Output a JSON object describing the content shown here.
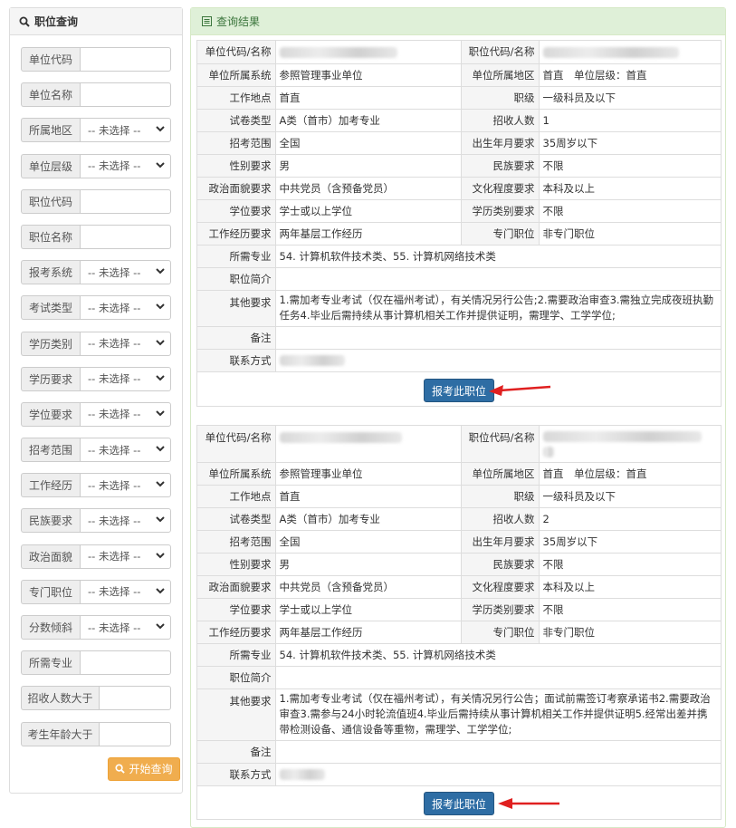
{
  "sidebar": {
    "title": "职位查询",
    "select_placeholder": "-- 未选择 --",
    "fields": [
      {
        "label": "单位代码",
        "type": "input"
      },
      {
        "label": "单位名称",
        "type": "input"
      },
      {
        "label": "所属地区",
        "type": "select"
      },
      {
        "label": "单位层级",
        "type": "select"
      },
      {
        "label": "职位代码",
        "type": "input"
      },
      {
        "label": "职位名称",
        "type": "input"
      },
      {
        "label": "报考系统",
        "type": "select"
      },
      {
        "label": "考试类型",
        "type": "select"
      },
      {
        "label": "学历类别",
        "type": "select"
      },
      {
        "label": "学历要求",
        "type": "select"
      },
      {
        "label": "学位要求",
        "type": "select"
      },
      {
        "label": "招考范围",
        "type": "select"
      },
      {
        "label": "工作经历",
        "type": "select"
      },
      {
        "label": "民族要求",
        "type": "select"
      },
      {
        "label": "政治面貌",
        "type": "select"
      },
      {
        "label": "专门职位",
        "type": "select"
      },
      {
        "label": "分数倾斜",
        "type": "select"
      },
      {
        "label": "所需专业",
        "type": "input"
      },
      {
        "label": "招收人数大于",
        "type": "input"
      },
      {
        "label": "考生年龄大于",
        "type": "input"
      }
    ],
    "search_button": "开始查询"
  },
  "results": {
    "title": "查询结果",
    "apply_button": "报考此职位",
    "labels": {
      "unit_code_name": "单位代码/名称",
      "position_code_name": "职位代码/名称",
      "unit_system": "单位所属系统",
      "unit_region": "单位所属地区",
      "work_location": "工作地点",
      "rank": "职级",
      "exam_type": "试卷类型",
      "recruit_count": "招收人数",
      "scope": "招考范围",
      "birth_req": "出生年月要求",
      "gender": "性别要求",
      "ethnicity": "民族要求",
      "political": "政治面貌要求",
      "education": "文化程度要求",
      "degree": "学位要求",
      "edu_category": "学历类别要求",
      "work_exp": "工作经历要求",
      "special_position": "专门职位",
      "major": "所需专业",
      "intro": "职位简介",
      "other": "其他要求",
      "remark": "备注",
      "contact": "联系方式"
    },
    "cards": [
      {
        "unit_system": "参照管理事业单位",
        "unit_region": "首直　单位层级：首直",
        "work_location": "首直",
        "rank": "一级科员及以下",
        "exam_type": "A类（首市）加考专业",
        "recruit_count": "1",
        "scope": "全国",
        "birth_req": "35周岁以下",
        "gender": "男",
        "ethnicity": "不限",
        "political": "中共党员（含预备党员）",
        "education": "本科及以上",
        "degree": "学士或以上学位",
        "edu_category": "不限",
        "work_exp": "两年基层工作经历",
        "special_position": "非专门职位",
        "major": "54. 计算机软件技术类、55. 计算机网络技术类",
        "intro": "",
        "other": "1.需加考专业考试（仅在福州考试），有关情况另行公告;2.需要政治审查3.需独立完成夜班执勤任务4.毕业后需持续从事计算机相关工作并提供证明，需理学、工学学位;",
        "remark": ""
      },
      {
        "unit_system": "参照管理事业单位",
        "unit_region": "首直　单位层级：首直",
        "work_location": "首直",
        "rank": "一级科员及以下",
        "exam_type": "A类（首市）加考专业",
        "recruit_count": "2",
        "scope": "全国",
        "birth_req": "35周岁以下",
        "gender": "男",
        "ethnicity": "不限",
        "political": "中共党员（含预备党员）",
        "education": "本科及以上",
        "degree": "学士或以上学位",
        "edu_category": "不限",
        "work_exp": "两年基层工作经历",
        "special_position": "非专门职位",
        "major": "54. 计算机软件技术类、55. 计算机网络技术类",
        "intro": "",
        "other": "1.需加考专业考试（仅在福州考试），有关情况另行公告；面试前需签订考察承诺书2.需要政治审查3.需参与24小时轮流值班4.毕业后需持续从事计算机相关工作并提供证明5.经常出差并携带检测设备、通信设备等重物，需理学、工学学位;",
        "remark": ""
      }
    ]
  }
}
